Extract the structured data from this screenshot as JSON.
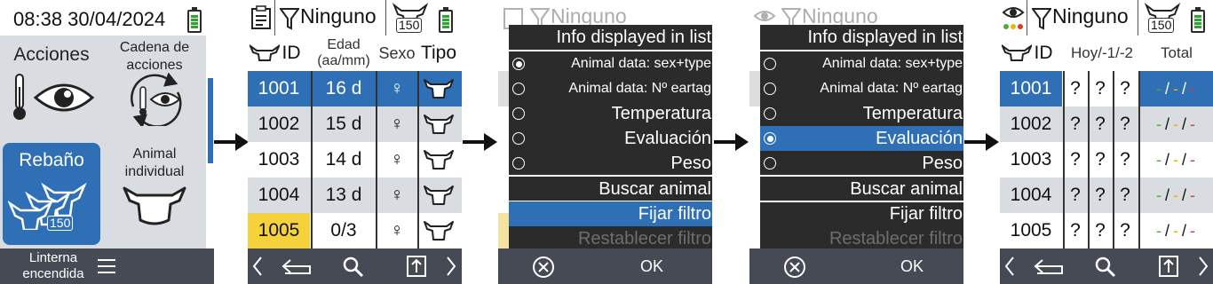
{
  "panel1": {
    "datetime": "08:38 30/04/2024",
    "actions_label": "Acciones",
    "chain_label": "Cadena de acciones",
    "herd_label": "Rebaño",
    "herd_count": "150",
    "animal_label": "Animal individual",
    "bottom_label": "Linterna encendida",
    "icons": [
      "thermometer-icon",
      "eye-icon",
      "cycle-icon",
      "herd-icon",
      "cow-head-icon",
      "menu-icon"
    ]
  },
  "panel2": {
    "filter_label": "Ninguno",
    "herd_count": "150",
    "headers": [
      "ID",
      "Edad (aa/mm)",
      "Sexo",
      "Tipo"
    ],
    "rows": [
      {
        "id": "1001",
        "age": "16 d",
        "sex": "♀"
      },
      {
        "id": "1002",
        "age": "15 d",
        "sex": "♀"
      },
      {
        "id": "1003",
        "age": "14 d",
        "sex": "♀"
      },
      {
        "id": "1004",
        "age": "13 d",
        "sex": "♀"
      },
      {
        "id": "1005",
        "age": "0/3",
        "sex": "♀"
      }
    ]
  },
  "panel3": {
    "filter_label": "Ninguno",
    "menu_title": "Info displayed in list",
    "options": [
      {
        "label": "Animal data: sex+type",
        "selected": true
      },
      {
        "label": "Animal data: Nº eartag",
        "selected": false
      },
      {
        "label": "Temperatura",
        "selected": false
      },
      {
        "label": "Evaluación",
        "selected": false
      },
      {
        "label": "Peso",
        "selected": false
      }
    ],
    "actions": [
      "Buscar animal",
      "Fijar filtro",
      "Restablecer filtro"
    ],
    "ok_label": "OK"
  },
  "panel4": {
    "filter_label": "Ninguno",
    "menu_title": "Info displayed in list",
    "options": [
      {
        "label": "Animal data: sex+type",
        "selected": false
      },
      {
        "label": "Animal data: Nº eartag",
        "selected": false
      },
      {
        "label": "Temperatura",
        "selected": false
      },
      {
        "label": "Evaluación",
        "selected": true
      },
      {
        "label": "Peso",
        "selected": false
      }
    ],
    "actions": [
      "Buscar animal",
      "Fijar filtro",
      "Restablecer filtro"
    ],
    "ok_label": "OK"
  },
  "panel5": {
    "filter_label": "Ninguno",
    "herd_count": "150",
    "headers": [
      "ID",
      "Hoy/-1/-2",
      "Total"
    ],
    "rows": [
      {
        "id": "1001",
        "q1": "?",
        "q2": "?",
        "q3": "?"
      },
      {
        "id": "1002",
        "q1": "?",
        "q2": "?",
        "q3": "?"
      },
      {
        "id": "1003",
        "q1": "?",
        "q2": "?",
        "q3": "?"
      },
      {
        "id": "1004",
        "q1": "?",
        "q2": "?",
        "q3": "?"
      },
      {
        "id": "1005",
        "q1": "?",
        "q2": "?",
        "q3": "?"
      }
    ],
    "total_parts": [
      "-",
      "/",
      "-",
      "/",
      "-"
    ]
  },
  "colors": {
    "selection_blue": "#2f6fb6",
    "bottom_bar": "#464a55",
    "row_alt": "#d9dde2",
    "highlight_yellow": "#f5d23c",
    "dash_green": "#4caf2e",
    "dash_yellow": "#e6b800",
    "dash_red": "#d83a2e"
  }
}
